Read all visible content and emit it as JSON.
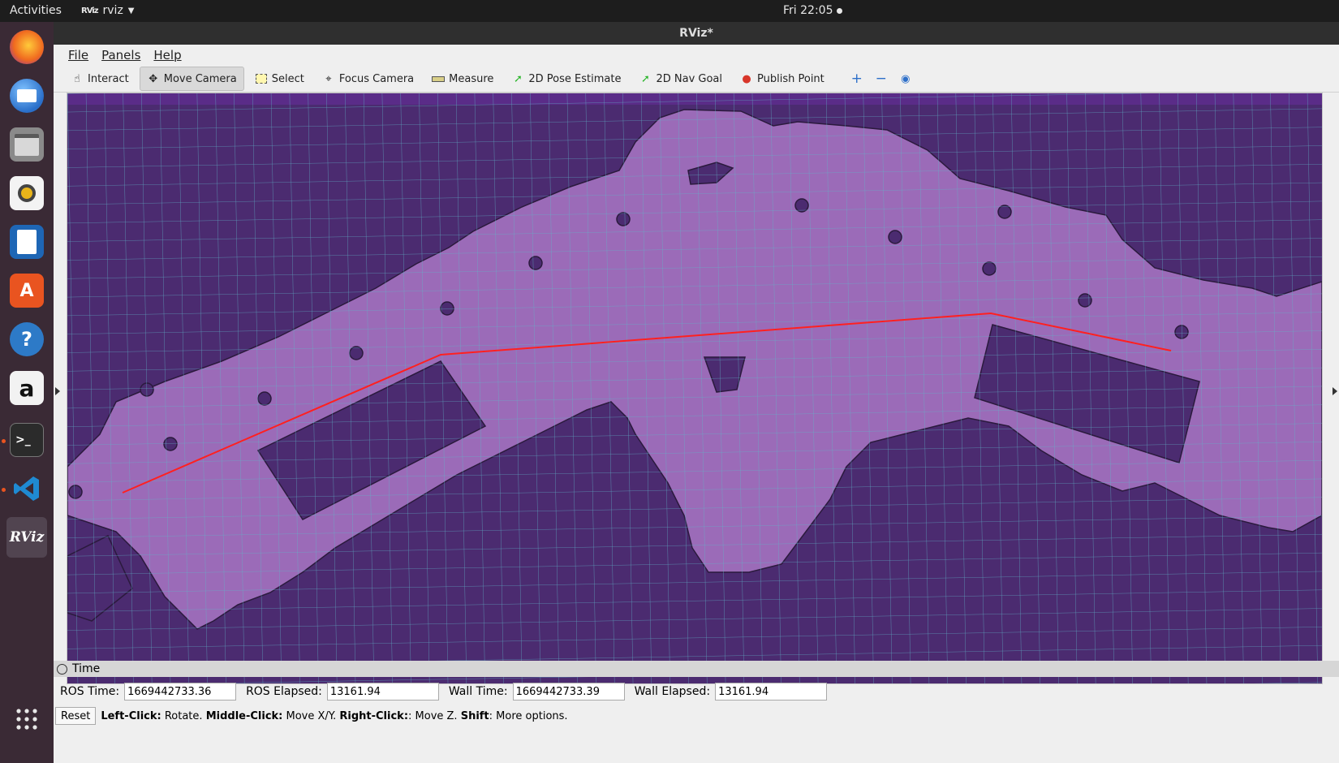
{
  "topbar": {
    "activities": "Activities",
    "app": "rviz",
    "app_logo": "RViz",
    "clock": "Fri 22:05"
  },
  "dock": {
    "items": [
      {
        "name": "firefox-icon",
        "color": "#e76e1c"
      },
      {
        "name": "thunderbird-icon",
        "color": "#2a6fc9"
      },
      {
        "name": "files-icon",
        "color": "#8a8a8a"
      },
      {
        "name": "rhythmbox-icon",
        "color": "#e9b51a"
      },
      {
        "name": "writer-icon",
        "color": "#1e66b5"
      },
      {
        "name": "software-icon",
        "color": "#e95420"
      },
      {
        "name": "help-icon",
        "color": "#2d7ac7"
      },
      {
        "name": "amazon-icon",
        "color": "#f2f2f2"
      },
      {
        "name": "terminal-icon",
        "color": "#2b2b2b"
      },
      {
        "name": "vscode-icon",
        "color": "#1f8ad2"
      },
      {
        "name": "rviz-icon",
        "color": "#3b3b3b"
      },
      {
        "name": "show-apps-icon",
        "color": "#3a2a35"
      }
    ],
    "amazon_glyph": "a",
    "help_glyph": "?",
    "rviz_glyph": "RViz"
  },
  "window": {
    "title": "RViz*"
  },
  "menu": {
    "file": "File",
    "panels": "Panels",
    "help": "Help"
  },
  "toolbar": {
    "interact": "Interact",
    "move_camera": "Move Camera",
    "select": "Select",
    "focus_camera": "Focus Camera",
    "measure": "Measure",
    "pose_estimate": "2D Pose Estimate",
    "nav_goal": "2D Nav Goal",
    "publish_point": "Publish Point"
  },
  "time_panel": {
    "header": "Time",
    "ros_time_label": "ROS Time:",
    "ros_time": "1669442733.36",
    "ros_elapsed_label": "ROS Elapsed:",
    "ros_elapsed": "13161.94",
    "wall_time_label": "Wall Time:",
    "wall_time": "1669442733.39",
    "wall_elapsed_label": "Wall Elapsed:",
    "wall_elapsed": "13161.94"
  },
  "status": {
    "reset": "Reset",
    "left_click": "Left-Click:",
    "left_action": "Rotate.",
    "middle_click": "Middle-Click:",
    "middle_action": "Move X/Y.",
    "right_click": "Right-Click:",
    "right_action": ": Move Z.",
    "shift": "Shift",
    "shift_action": ": More options."
  },
  "colors": {
    "map_unknown": "#4b2b70",
    "map_free": "#9b6bb8",
    "grid": "#5fb4c8",
    "path": "#ff2020"
  }
}
